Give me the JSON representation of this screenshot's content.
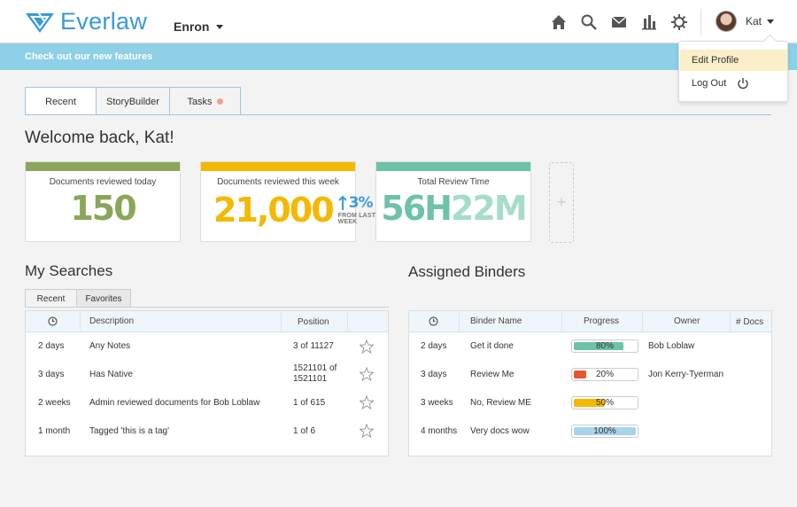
{
  "app": {
    "name": "Everlaw",
    "project": "Enron"
  },
  "user": {
    "name": "Kat"
  },
  "banner": {
    "text": "Check out our new features"
  },
  "dropdown": {
    "items": [
      {
        "label": "Edit Profile"
      },
      {
        "label": "Log Out"
      }
    ]
  },
  "nav_icons": [
    "home-icon",
    "search-icon",
    "mail-icon",
    "bar-chart-icon",
    "settings-gear-icon"
  ],
  "tabs": [
    {
      "label": "Recent"
    },
    {
      "label": "StoryBuilder"
    },
    {
      "label": "Tasks"
    }
  ],
  "welcome": "Welcome back, Kat!",
  "stats": [
    {
      "label": "Documents reviewed today",
      "value": "150",
      "color": "#8aa65a"
    },
    {
      "label": "Documents reviewed this week",
      "value": "21,000",
      "color": "#f5b800",
      "change": "3%",
      "change_caption": "FROM LAST WEEK"
    },
    {
      "label": "Total Review Time",
      "value_hours": "56H",
      "value_minutes": "22M",
      "color": "#6cc3a9",
      "color_light": "#a5dccb"
    }
  ],
  "searches": {
    "title": "My Searches",
    "tabs": [
      {
        "label": "Recent"
      },
      {
        "label": "Favorites"
      }
    ],
    "headers": {
      "description": "Description",
      "position": "Position"
    },
    "rows": [
      {
        "time": "2 days",
        "description": "Any Notes",
        "position": "3 of 11127"
      },
      {
        "time": "3 days",
        "description": "Has Native",
        "position_line1": "1521101 of",
        "position_line2": "1521101"
      },
      {
        "time": "2 weeks",
        "description": "Admin reviewed documents for Bob Loblaw",
        "position": "1 of 615"
      },
      {
        "time": "1 month",
        "description": "Tagged 'this is a tag'",
        "position": "1 of 6"
      }
    ]
  },
  "binders": {
    "title": "Assigned Binders",
    "headers": {
      "name": "Binder Name",
      "progress": "Progress",
      "owner": "Owner",
      "docs": "# Docs"
    },
    "rows": [
      {
        "time": "2 days",
        "name": "Get it done",
        "progress": 80,
        "progress_label": "80%",
        "color": "#6cc3a9",
        "owner": "Bob Loblaw"
      },
      {
        "time": "3 days",
        "name": "Review Me",
        "progress": 20,
        "progress_label": "20%",
        "color": "#e8552f",
        "owner": "Jon Kerry-Tyerman"
      },
      {
        "time": "3 weeks",
        "name": "No, Review ME",
        "progress": 50,
        "progress_label": "50%",
        "color": "#f5b800",
        "owner": ""
      },
      {
        "time": "4 months",
        "name": "Very docs wow",
        "progress": 100,
        "progress_label": "100%",
        "color": "#a9d3ea",
        "owner": ""
      }
    ]
  }
}
